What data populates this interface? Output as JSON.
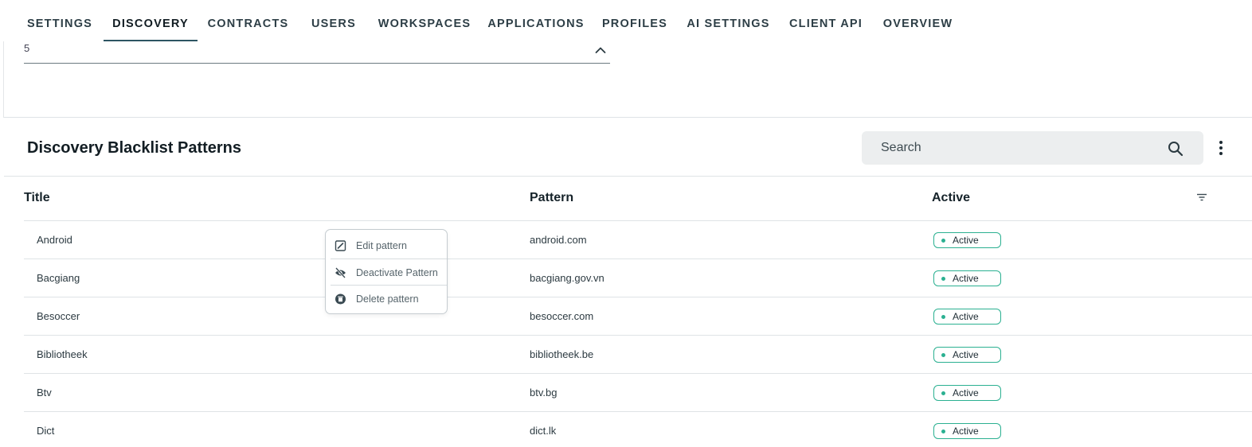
{
  "tabs": [
    {
      "label": "SETTINGS"
    },
    {
      "label": "DISCOVERY"
    },
    {
      "label": "CONTRACTS"
    },
    {
      "label": "USERS"
    },
    {
      "label": "WORKSPACES"
    },
    {
      "label": "APPLICATIONS"
    },
    {
      "label": "PROFILES"
    },
    {
      "label": "AI SETTINGS"
    },
    {
      "label": "CLIENT API"
    },
    {
      "label": "OVERVIEW"
    }
  ],
  "active_tab": "DISCOVERY",
  "select_field": {
    "value": "5"
  },
  "section": {
    "title": "Discovery Blacklist Patterns",
    "search_placeholder": "Search"
  },
  "table": {
    "columns": {
      "title": "Title",
      "pattern": "Pattern",
      "active": "Active"
    },
    "rows": [
      {
        "title": "Android",
        "pattern": "android.com",
        "status": "Active"
      },
      {
        "title": "Bacgiang",
        "pattern": "bacgiang.gov.vn",
        "status": "Active"
      },
      {
        "title": "Besoccer",
        "pattern": "besoccer.com",
        "status": "Active"
      },
      {
        "title": "Bibliotheek",
        "pattern": "bibliotheek.be",
        "status": "Active"
      },
      {
        "title": "Btv",
        "pattern": "btv.bg",
        "status": "Active"
      },
      {
        "title": "Dict",
        "pattern": "dict.lk",
        "status": "Active"
      }
    ]
  },
  "context_menu": {
    "items": [
      {
        "label": "Edit pattern",
        "icon": "edit-icon"
      },
      {
        "label": "Deactivate Pattern",
        "icon": "eye-off-icon"
      },
      {
        "label": "Delete pattern",
        "icon": "trash-icon"
      }
    ]
  },
  "colors": {
    "active_badge": "#2bb091",
    "tab_underline": "#2d5563",
    "search_bg": "#eceeef"
  }
}
